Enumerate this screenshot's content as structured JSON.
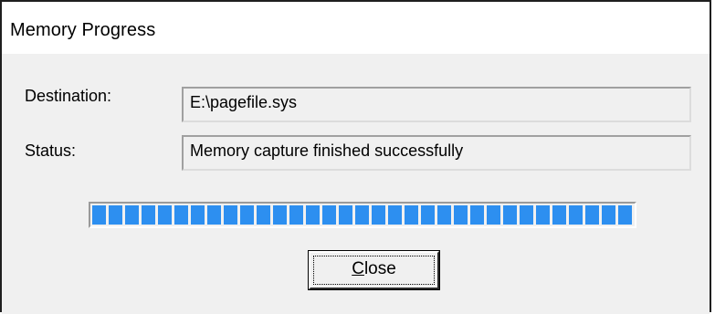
{
  "window": {
    "title": "Memory Progress"
  },
  "form": {
    "destination_label": "Destination:",
    "destination_value": "E:\\pagefile.sys",
    "status_label": "Status:",
    "status_value": "Memory capture finished successfully"
  },
  "progress": {
    "value_percent": 100,
    "color": "#2d8ff0"
  },
  "buttons": {
    "close_accel": "C",
    "close_rest": "lose"
  }
}
